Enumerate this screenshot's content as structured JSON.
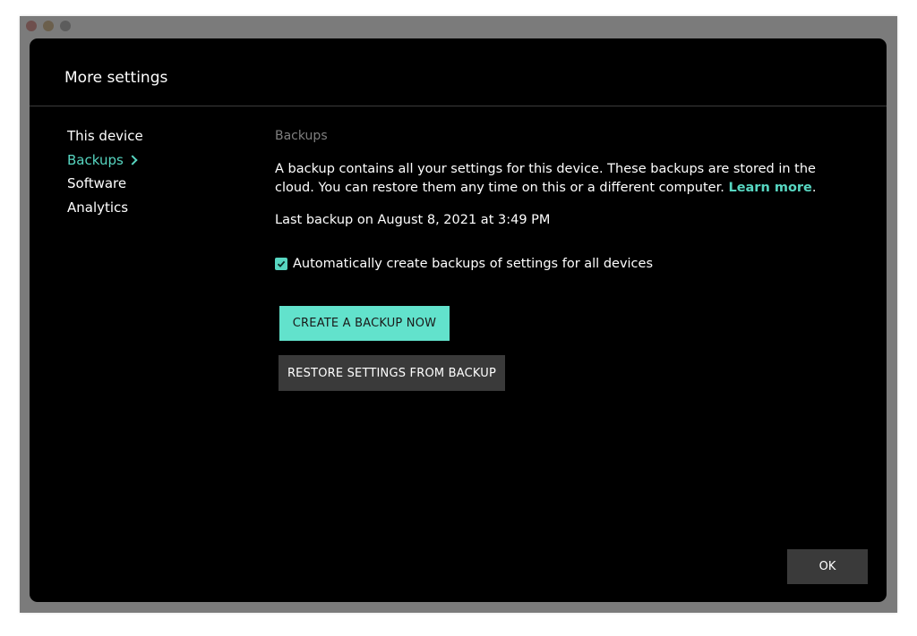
{
  "window": {
    "traffic_lights": [
      "close",
      "minimize",
      "maximize"
    ]
  },
  "dialog": {
    "title": "More settings"
  },
  "sidebar": {
    "items": [
      {
        "label": "This device",
        "active": false
      },
      {
        "label": "Backups",
        "active": true
      },
      {
        "label": "Software",
        "active": false
      },
      {
        "label": "Analytics",
        "active": false
      }
    ]
  },
  "content": {
    "section_heading": "Backups",
    "description": "A backup contains all your settings for this device. These backups are stored in the cloud. You can restore them any time on this or a different computer.",
    "learn_more": "Learn more",
    "description_end": ".",
    "last_backup": "Last backup on August 8, 2021 at 3:49 PM",
    "auto_backup_label": "Automatically create backups of settings for all devices",
    "auto_backup_checked": true,
    "create_backup_label": "CREATE A BACKUP NOW",
    "restore_label": "RESTORE SETTINGS FROM BACKUP"
  },
  "footer": {
    "ok_label": "OK"
  },
  "colors": {
    "accent": "#57d6c1",
    "primary_button": "#62e2cc",
    "secondary_button": "#3a3a3a",
    "background": "#000000"
  },
  "icons": {
    "chevron": "chevron-right-icon",
    "checkbox": "checkmark-icon"
  }
}
